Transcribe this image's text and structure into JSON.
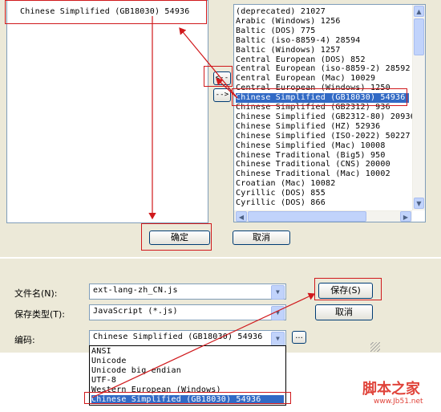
{
  "top_dialog": {
    "selected_list": [
      "Chinese Simplified (GB18030) 54936"
    ],
    "available_list": [
      "(deprecated) 21027",
      "Arabic (Windows) 1256",
      "Baltic (DOS) 775",
      "Baltic (iso-8859-4) 28594",
      "Baltic (Windows) 1257",
      "Central European (DOS) 852",
      "Central European (iso-8859-2) 28592",
      "Central European (Mac) 10029",
      "Central European (Windows) 1250",
      "Chinese Simplified (GB18030) 54936",
      "Chinese Simplified (GB2312) 936",
      "Chinese Simplified (GB2312-80) 20936",
      "Chinese Simplified (HZ) 52936",
      "Chinese Simplified (ISO-2022) 50227",
      "Chinese Simplified (Mac) 10008",
      "Chinese Traditional (Big5) 950",
      "Chinese Traditional (CNS) 20000",
      "Chinese Traditional (Mac) 10002",
      "Croatian (Mac) 10082",
      "Cyrillic (DOS) 855",
      "Cyrillic (DOS) 866"
    ],
    "selected_index": 9,
    "add_button": "<--",
    "remove_button": "-->",
    "ok_button": "确定",
    "cancel_button": "取消"
  },
  "save_dialog": {
    "filename_label": "文件名(N):",
    "filename_value": "ext-lang-zh_CN.js",
    "filetype_label": "保存类型(T):",
    "filetype_value": "JavaScript (*.js)",
    "encoding_label": "编码:",
    "encoding_value": "Chinese Simplified (GB18030) 54936",
    "save_button": "保存(S)",
    "cancel_button": "取消",
    "more_button": "...",
    "encoding_options": [
      "ANSI",
      "Unicode",
      "Unicode big endian",
      "UTF-8",
      "Western European (Windows)",
      "Chinese Simplified (GB18030) 54936"
    ],
    "encoding_selected_index": 5
  },
  "watermark": {
    "text": "脚本之家",
    "url": "www.Jb51.net"
  },
  "colors": {
    "annotation_red": "#d0191c",
    "selection_blue": "#316ac5",
    "dialog_bg": "#ece9d8"
  }
}
